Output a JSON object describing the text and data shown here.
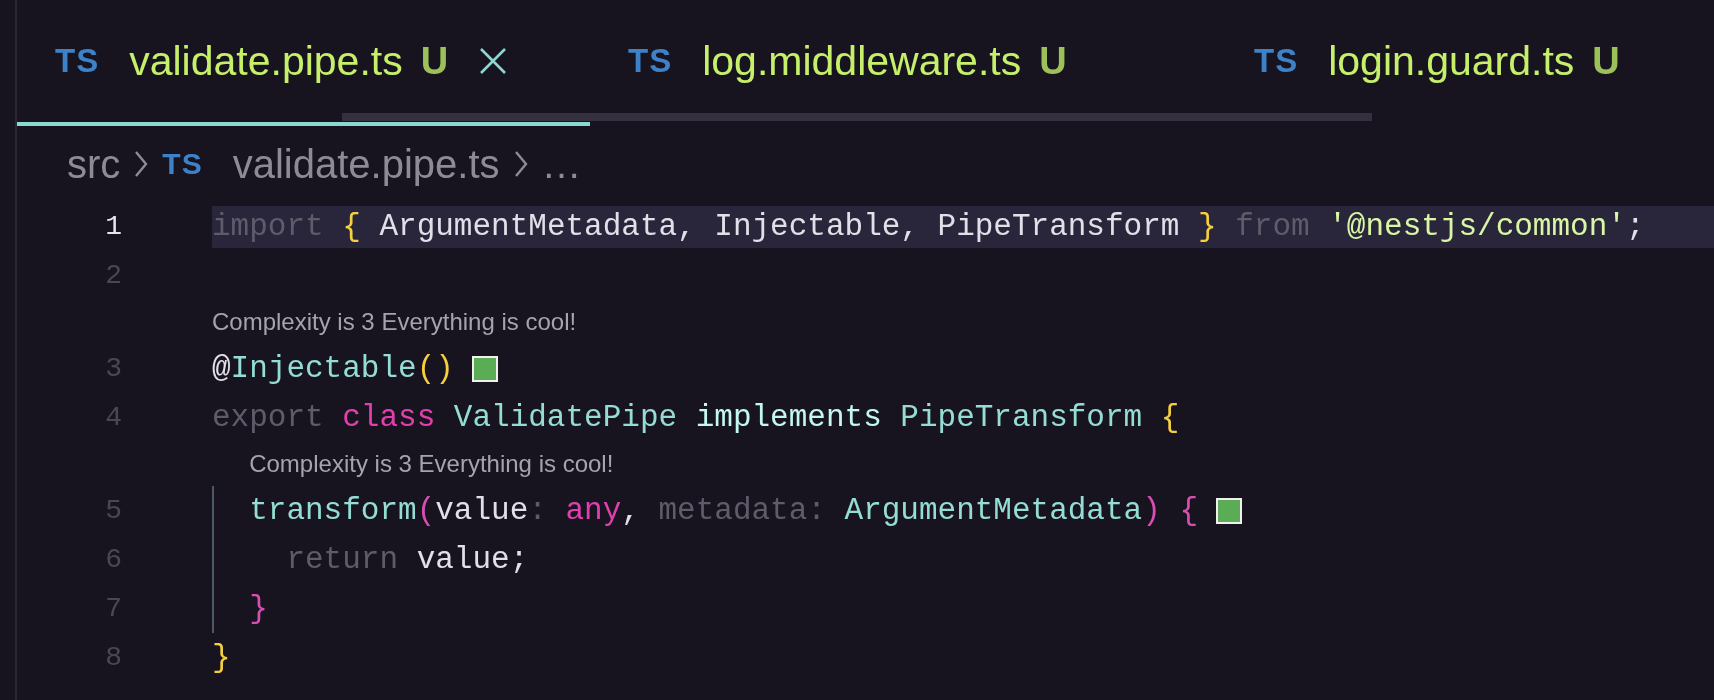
{
  "tabs": [
    {
      "type_label": "TS",
      "label": "validate.pipe.ts",
      "status": "U",
      "selected": true
    },
    {
      "type_label": "TS",
      "label": "log.middleware.ts",
      "status": "U",
      "selected": false
    },
    {
      "type_label": "TS",
      "label": "login.guard.ts",
      "status": "U",
      "selected": false
    }
  ],
  "breadcrumb": [
    {
      "label": "src"
    },
    {
      "type_label": "TS",
      "label": "validate.pipe.ts"
    },
    {
      "label": "…"
    }
  ],
  "lines": [
    {
      "kind": "code",
      "number": "1",
      "current": true,
      "swatch": false,
      "tokens": [
        {
          "text": "import ",
          "kind": "keyword"
        },
        {
          "text": "{ ",
          "kind": "bracket1"
        },
        {
          "text": "ArgumentMetadata, Injectable, PipeTransform ",
          "kind": "plain"
        },
        {
          "text": "} ",
          "kind": "bracket1"
        },
        {
          "text": "from ",
          "kind": "keyword"
        },
        {
          "text": "'@nestjs/common'",
          "kind": "string"
        },
        {
          "text": ";",
          "kind": "plain"
        }
      ]
    },
    {
      "kind": "code",
      "number": "2",
      "current": false,
      "swatch": false
    },
    {
      "kind": "lens",
      "text": "Complexity is 3 Everything is cool!"
    },
    {
      "kind": "code",
      "number": "3",
      "current": false,
      "swatch": true,
      "tokens": [
        {
          "text": "@",
          "kind": "plain"
        },
        {
          "text": "Injectable",
          "kind": "type"
        },
        {
          "text": "()",
          "kind": "bracket1"
        }
      ]
    },
    {
      "kind": "code",
      "number": "4",
      "current": false,
      "swatch": false,
      "tokens": [
        {
          "text": "export ",
          "kind": "keyword"
        },
        {
          "text": "class ",
          "kind": "keyword2"
        },
        {
          "text": "ValidatePipe ",
          "kind": "type"
        },
        {
          "text": "implements ",
          "kind": "modifier"
        },
        {
          "text": "PipeTransform ",
          "kind": "type"
        },
        {
          "text": "{",
          "kind": "bracket1"
        }
      ]
    },
    {
      "kind": "lens",
      "text": "Complexity is 3 Everything is cool!"
    },
    {
      "kind": "code",
      "number": "5",
      "current": false,
      "swatch": true,
      "tokens": [
        {
          "text": "  transform",
          "kind": "type"
        },
        {
          "text": "(",
          "kind": "bracket2"
        },
        {
          "text": "value",
          "kind": "plain"
        },
        {
          "text": ": ",
          "kind": "keyword"
        },
        {
          "text": "any",
          "kind": "keyword2"
        },
        {
          "text": ", ",
          "kind": "plain"
        },
        {
          "text": "metadata: ",
          "kind": "keyword"
        },
        {
          "text": "ArgumentMetadata",
          "kind": "type"
        },
        {
          "text": ") {",
          "kind": "bracket2"
        }
      ]
    },
    {
      "kind": "code",
      "number": "6",
      "current": false,
      "swatch": false,
      "tokens": [
        {
          "text": "    return ",
          "kind": "keyword"
        },
        {
          "text": "value;",
          "kind": "plain"
        }
      ]
    },
    {
      "kind": "code",
      "number": "7",
      "current": false,
      "swatch": false,
      "tokens": [
        {
          "text": "  }",
          "kind": "bracket2"
        }
      ]
    },
    {
      "kind": "code",
      "number": "8",
      "current": false,
      "swatch": false,
      "tokens": [
        {
          "text": "}",
          "kind": "bracket1"
        }
      ]
    }
  ]
}
